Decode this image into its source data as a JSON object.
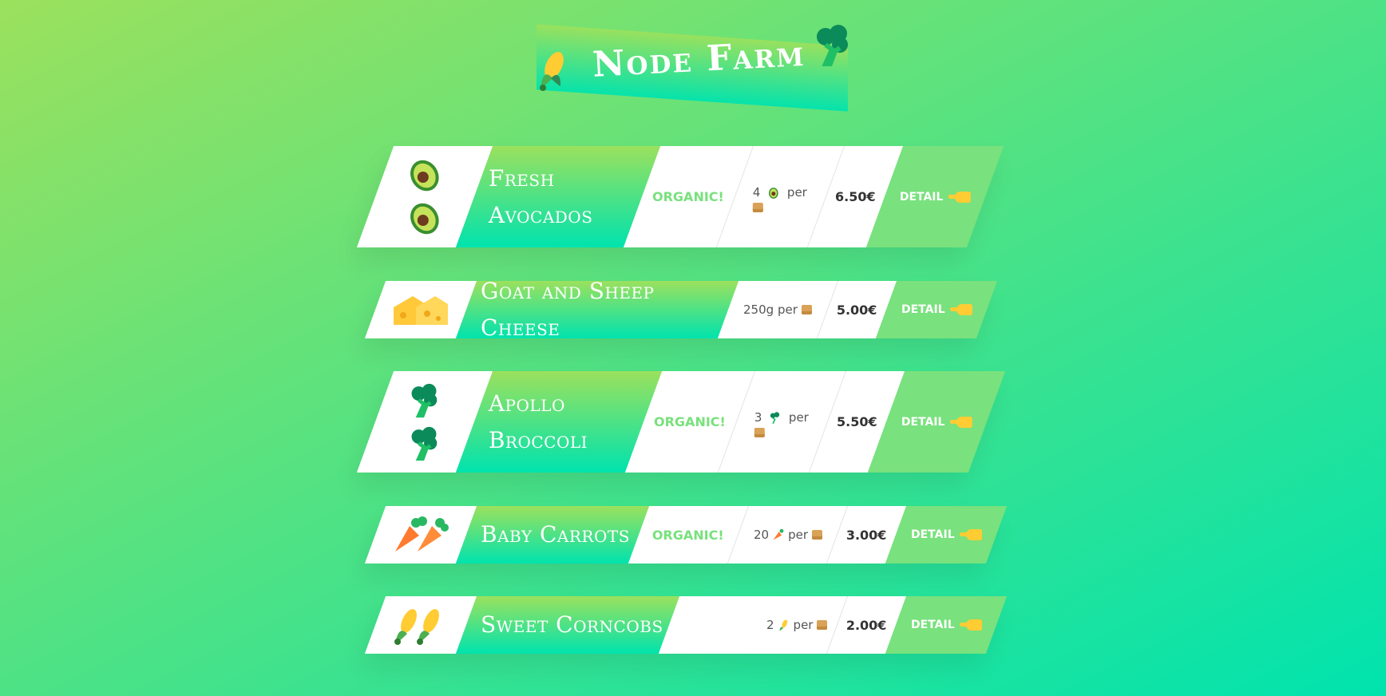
{
  "header": {
    "title": "Node Farm",
    "icon_left": "corn-icon",
    "icon_right": "broccoli-icon"
  },
  "theme": {
    "gradient_start": "#9be15d",
    "gradient_end": "#00e3ae",
    "detail_bg": "#79e17d",
    "organic_color": "#79e17d"
  },
  "products": [
    {
      "name_lines": [
        "Fresh",
        "Avocados"
      ],
      "emoji": "avocado-icon",
      "organic": "ORGANIC!",
      "quantity": "4",
      "qty_unit": "per",
      "price": "6.50€",
      "detail": "DETAIL"
    },
    {
      "name_lines": [
        "Goat and Sheep Cheese"
      ],
      "emoji": "cheese-icon",
      "organic": "",
      "quantity": "250g",
      "qty_unit": "per",
      "price": "5.00€",
      "detail": "DETAIL"
    },
    {
      "name_lines": [
        "Apollo",
        "Broccoli"
      ],
      "emoji": "broccoli-icon",
      "organic": "ORGANIC!",
      "quantity": "3",
      "qty_unit": "per",
      "price": "5.50€",
      "detail": "DETAIL"
    },
    {
      "name_lines": [
        "Baby Carrots"
      ],
      "emoji": "carrot-icon",
      "organic": "ORGANIC!",
      "quantity": "20",
      "qty_unit": "per",
      "price": "3.00€",
      "detail": "DETAIL"
    },
    {
      "name_lines": [
        "Sweet Corncobs"
      ],
      "emoji": "corn-icon",
      "organic": "",
      "quantity": "2",
      "qty_unit": "per",
      "price": "2.00€",
      "detail": "DETAIL"
    }
  ]
}
